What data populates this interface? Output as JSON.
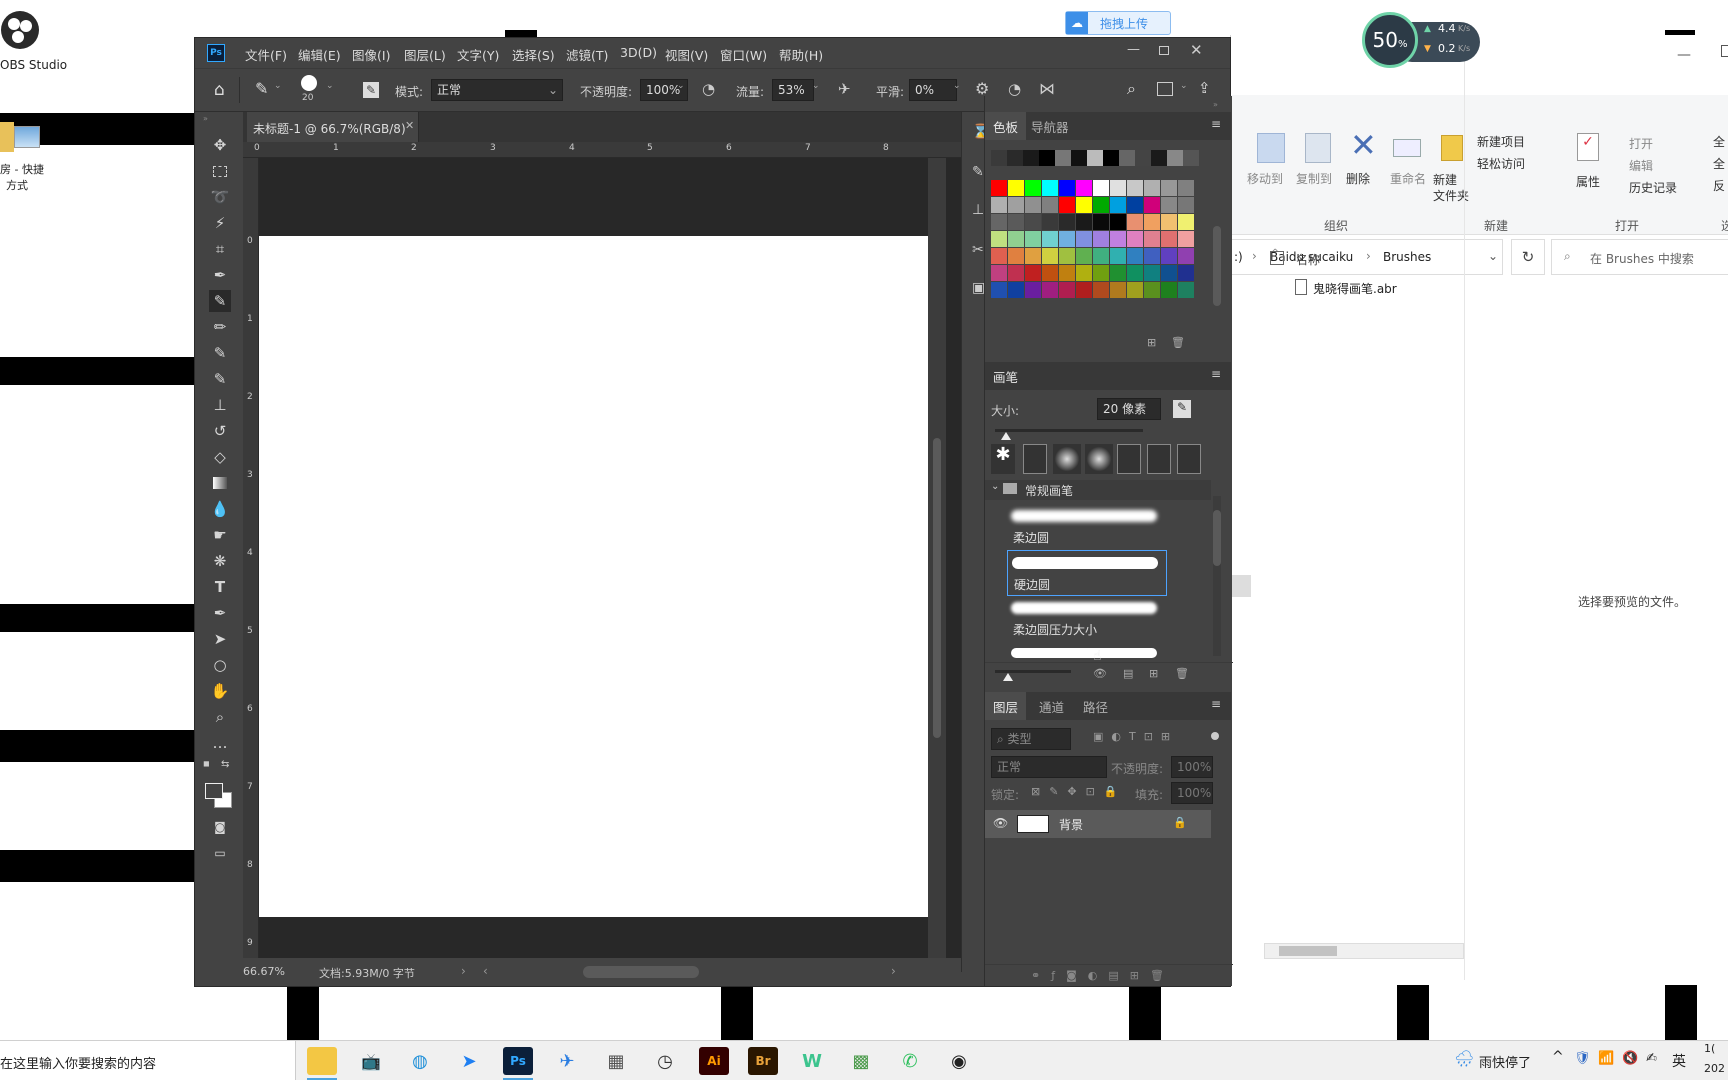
{
  "desktop": {
    "obs_label": "OBS Studio",
    "shortcut_label_1": "房 - 快捷",
    "shortcut_label_2": "方式"
  },
  "baidu_upload": {
    "label": "拖拽上传"
  },
  "speed_widget": {
    "percent": "50",
    "percent_unit": "%",
    "up": "4.4",
    "down": "0.2",
    "unit": "K/s"
  },
  "explorer": {
    "ribbon": {
      "move_to": "移动到",
      "copy_to": "复制到",
      "delete": "删除",
      "rename": "重命名",
      "new_folder_1": "新建",
      "new_folder_2": "文件夹",
      "new_item": "新建项目",
      "easy_access": "轻松访问",
      "properties": "属性",
      "open": "打开",
      "edit": "编辑",
      "history": "历史记录",
      "group_organize": "组织",
      "group_new": "新建",
      "group_open": "打开",
      "group_select": "选",
      "select_all_1": "全",
      "select_all_2": "全",
      "select_all_3": "反"
    },
    "breadcrumb": [
      ":)",
      "Baidu sucaiku",
      "Brushes"
    ],
    "search_placeholder": "在 Brushes 中搜索",
    "column_name": "名称",
    "files": [
      "鬼晓得画笔.abr"
    ],
    "preview_text": "选择要预览的文件。"
  },
  "photoshop": {
    "logo": "Ps",
    "menu": [
      "文件(F)",
      "编辑(E)",
      "图像(I)",
      "图层(L)",
      "文字(Y)",
      "选择(S)",
      "滤镜(T)",
      "3D(D)",
      "视图(V)",
      "窗口(W)",
      "帮助(H)"
    ],
    "options": {
      "brush_size": "20",
      "mode_label": "模式:",
      "mode_value": "正常",
      "opacity_label": "不透明度:",
      "opacity_value": "100%",
      "flow_label": "流量:",
      "flow_value": "53%",
      "smooth_label": "平滑:",
      "smooth_value": "0%"
    },
    "doc_tab": "未标题-1 @ 66.7%(RGB/8)",
    "ruler_h": [
      "0",
      "1",
      "2",
      "3",
      "4",
      "5",
      "6",
      "7",
      "8"
    ],
    "ruler_v": [
      "0",
      "1",
      "2",
      "3",
      "4",
      "5",
      "6",
      "7",
      "8",
      "9"
    ],
    "status": {
      "zoom": "66.67%",
      "doc": "文档:5.93M/0 字节"
    },
    "swatches_panel": {
      "tab_active": "色板",
      "tab_other": "导航器"
    },
    "brush_panel": {
      "title": "画笔",
      "size_label": "大小:",
      "size_value": "20 像素",
      "group_name": "常规画笔",
      "brushes": [
        "柔边圆",
        "硬边圆",
        "柔边圆压力大小"
      ]
    },
    "layers_panel": {
      "tabs": [
        "图层",
        "通道",
        "路径"
      ],
      "filter": "类型",
      "blend": "正常",
      "opacity_label": "不透明度:",
      "opacity_value": "100%",
      "lock_label": "锁定:",
      "fill_label": "填充:",
      "fill_value": "100%",
      "layer_name": "背景"
    },
    "colors": {
      "swatches": [
        "#ff0000",
        "#ffff00",
        "#00ff00",
        "#00ffff",
        "#0000ff",
        "#ff00ff",
        "#ffffff",
        "#c0c0c0",
        "#808080",
        "#404040",
        "#000000",
        "#ff8080",
        "#ffb080",
        "#fff080"
      ]
    }
  },
  "taskbar": {
    "search_placeholder": "在这里输入你要搜索的内容",
    "apps": [
      "Ps",
      "Ai",
      "Br",
      "W"
    ],
    "weather": "雨快停了",
    "ime": "英",
    "clock_1": "1(",
    "clock_2": "202"
  }
}
